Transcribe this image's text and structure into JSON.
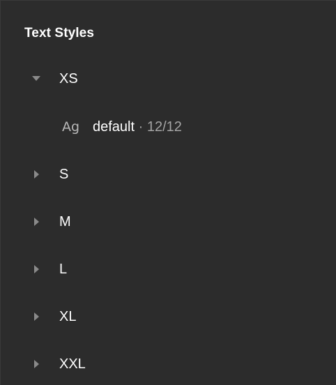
{
  "panel": {
    "title": "Text Styles"
  },
  "groups": [
    {
      "label": "XS",
      "expanded": true
    },
    {
      "label": "S",
      "expanded": false
    },
    {
      "label": "M",
      "expanded": false
    },
    {
      "label": "L",
      "expanded": false
    },
    {
      "label": "XL",
      "expanded": false
    },
    {
      "label": "XXL",
      "expanded": false
    }
  ],
  "styles": [
    {
      "icon_text": "Ag",
      "name": "default",
      "separator": " · ",
      "meta": "12/12"
    }
  ],
  "colors": {
    "background": "#2c2c2c",
    "text": "#ffffff",
    "muted": "#a5a5a5",
    "caret": "#8a8a8a"
  },
  "icons": {
    "expanded": "triangle-down-icon",
    "collapsed": "triangle-right-icon"
  }
}
